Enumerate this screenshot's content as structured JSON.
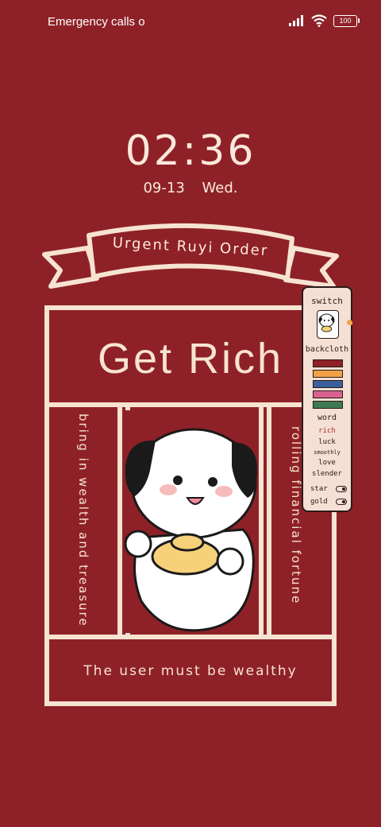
{
  "status_bar": {
    "carrier": "Emergency calls o",
    "battery": "100"
  },
  "lockscreen": {
    "time": "02:36",
    "date": "09-13",
    "weekday": "Wed."
  },
  "wallpaper": {
    "banner": "Urgent Ruyi Order",
    "title": "Get Rich",
    "left_vertical": "bring in wealth and treasure",
    "right_vertical": "rolling financial fortune",
    "footer": "The user must be wealthy"
  },
  "widget_panel": {
    "switch_label": "switch",
    "backcloth_label": "backcloth",
    "swatches": [
      "#8e2127",
      "#f0a24a",
      "#3a5f9a",
      "#d8618f",
      "#3f7a55"
    ],
    "word_label": "word",
    "words": [
      "rich",
      "luck",
      "smoothly",
      "love",
      "slender"
    ],
    "selected_word_color": "#b03030",
    "toggles": [
      {
        "label": "star"
      },
      {
        "label": "gold"
      }
    ]
  },
  "colors": {
    "background": "#8e2127",
    "cream": "#f7e3d2"
  }
}
